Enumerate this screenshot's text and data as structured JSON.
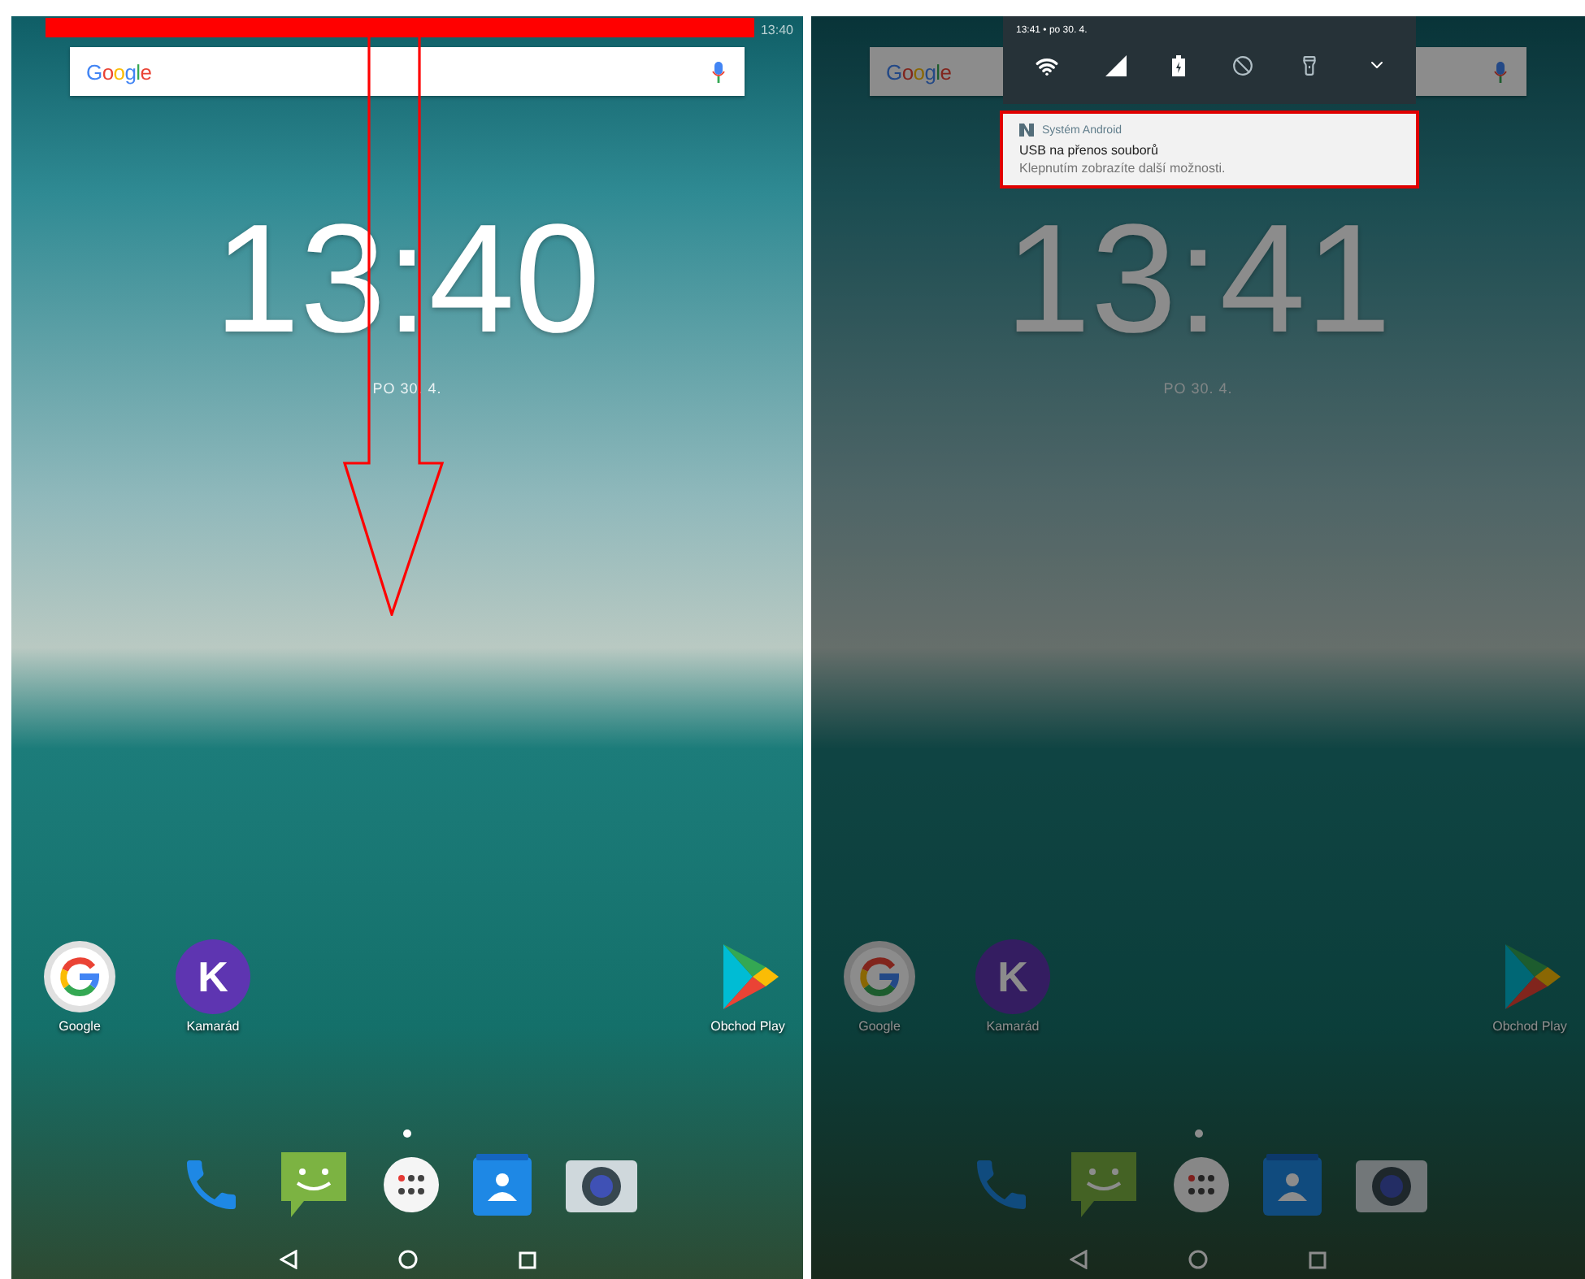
{
  "screens": [
    {
      "dimmed": false,
      "swipe_annotation": true,
      "status_time": "13:40",
      "search_logo": "Google",
      "clock": "13:40",
      "date": "PO 30. 4.",
      "apps": [
        {
          "kind": "g-logo",
          "label": "Google"
        },
        {
          "kind": "letter",
          "letter": "K",
          "label": "Kamarád"
        },
        {
          "kind": "triangle",
          "label": "Obchod Play"
        }
      ]
    },
    {
      "dimmed": true,
      "swipe_annotation": false,
      "search_logo": "Google",
      "clock": "13:41",
      "date": "PO 30. 4.",
      "apps": [
        {
          "kind": "g-logo",
          "label": "Google"
        },
        {
          "kind": "letter",
          "letter": "K",
          "label": "Kamarád"
        },
        {
          "kind": "triangle",
          "label": "Obchod Play"
        }
      ],
      "shade": {
        "header": "13:41 • po 30. 4.",
        "notification": {
          "app": "Systém Android",
          "title": "USB na přenos souborů",
          "text": "Klepnutím zobrazíte další možnosti.",
          "highlighted": true
        }
      }
    }
  ]
}
